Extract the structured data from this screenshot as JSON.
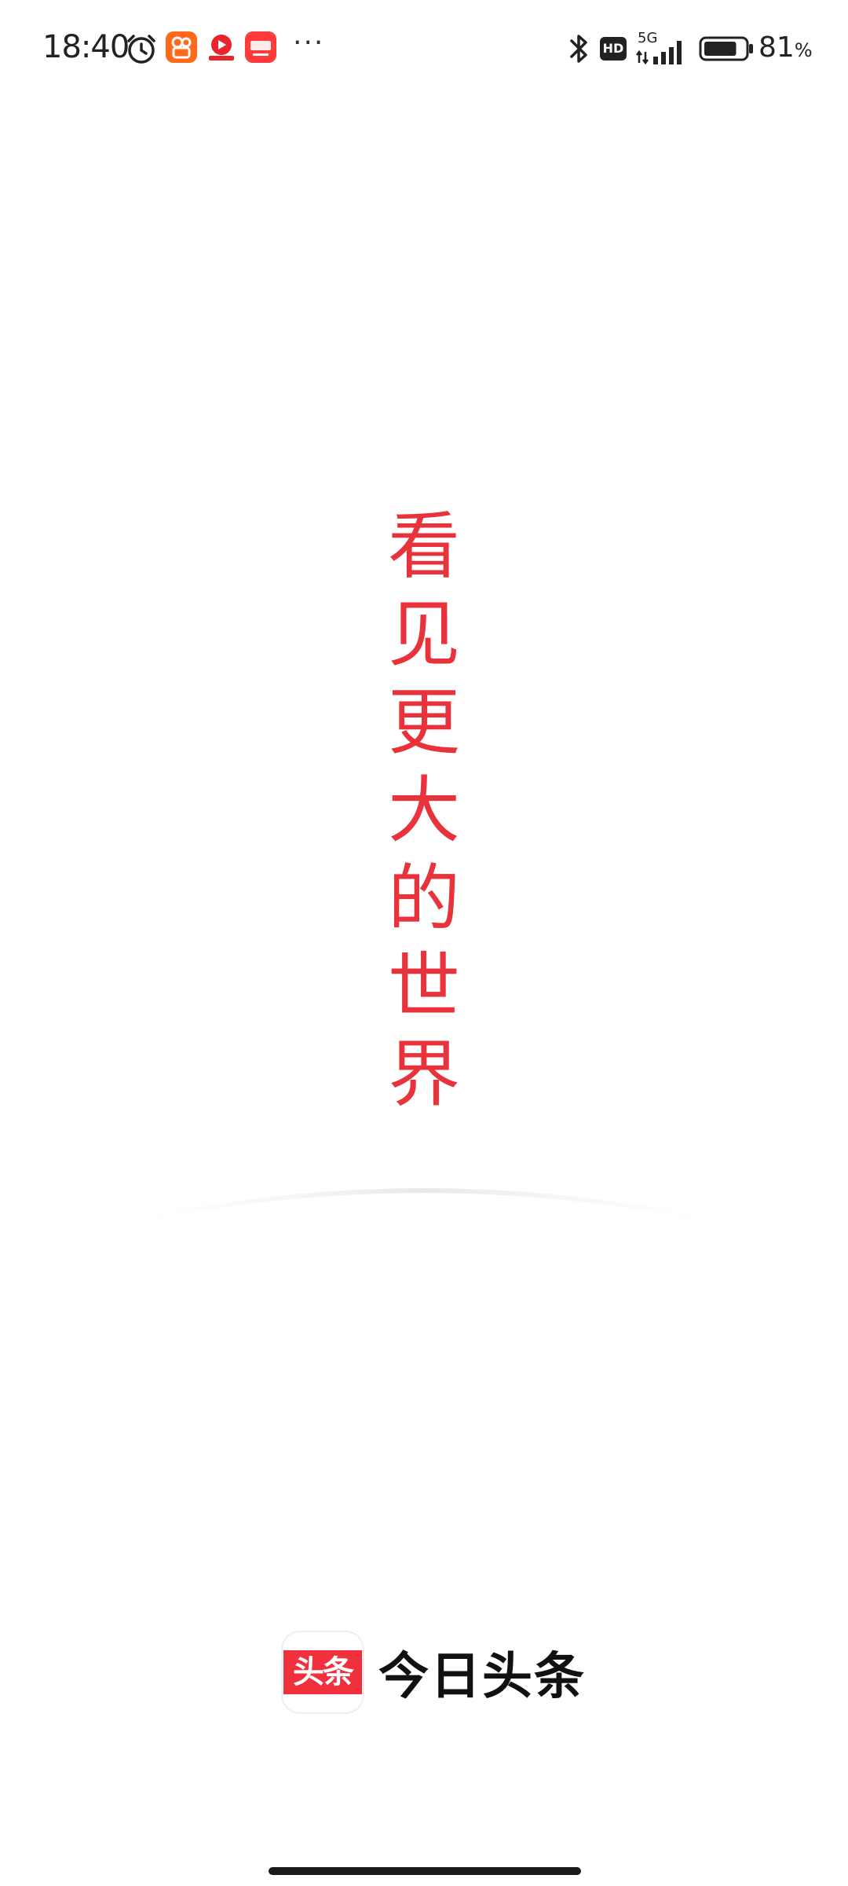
{
  "status_bar": {
    "time": "18:40",
    "more": "···",
    "hd": "HD",
    "network": "5G",
    "battery_value": "81",
    "battery_unit": "%",
    "battery_level": 0.81,
    "icons": [
      "alarm-icon",
      "bluetooth-icon",
      "signal-icon",
      "battery-icon"
    ]
  },
  "splash": {
    "slogan": [
      "看",
      "见",
      "更",
      "大",
      "的",
      "世",
      "界"
    ],
    "accent_color": "#e8323c"
  },
  "brand": {
    "logo_text": "头条",
    "name": "今日头条",
    "logo_color": "#f0303c"
  }
}
